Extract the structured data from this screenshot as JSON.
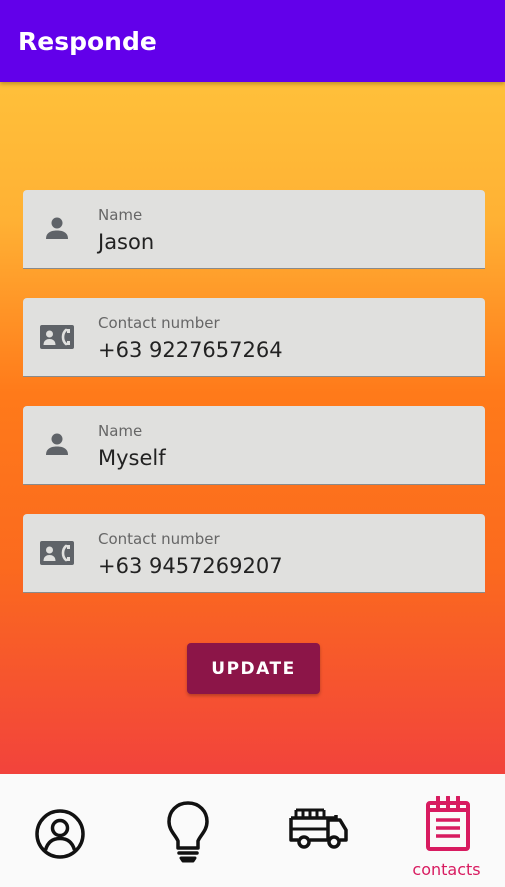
{
  "app": {
    "title": "Responde"
  },
  "form": {
    "fields": [
      {
        "label": "Name",
        "value": "Jason",
        "icon": "person-icon"
      },
      {
        "label": "Contact number",
        "value": "+63 9227657264",
        "icon": "contact-phone-icon"
      },
      {
        "label": "Name",
        "value": "Myself",
        "icon": "person-icon"
      },
      {
        "label": "Contact number",
        "value": "+63 9457269207",
        "icon": "contact-phone-icon"
      }
    ],
    "update_label": "UPDATE"
  },
  "bottom_nav": {
    "items": [
      {
        "icon": "profile-icon",
        "label": ""
      },
      {
        "icon": "lightbulb-icon",
        "label": ""
      },
      {
        "icon": "fire-truck-icon",
        "label": ""
      },
      {
        "icon": "notepad-icon",
        "label": "contacts",
        "selected": true
      }
    ]
  },
  "colors": {
    "app_bar": "#6200ea",
    "field_bg": "#e0e0de",
    "button": "#8c1548",
    "accent": "#d81b60",
    "gradient_top": "#ffc03a",
    "gradient_bottom": "#f2433c"
  }
}
